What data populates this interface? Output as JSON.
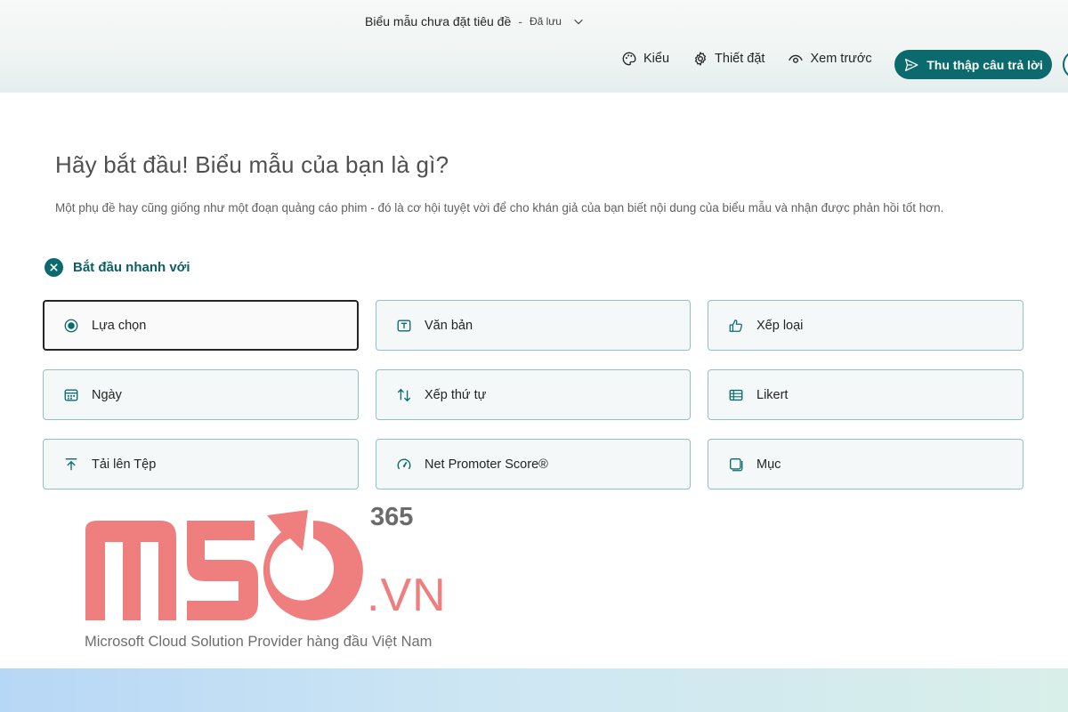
{
  "header": {
    "doc_title": "Biểu mẫu chưa đặt tiêu đề",
    "separator": "-",
    "save_status": "Đã lưu",
    "toolbar": {
      "style_label": "Kiểu",
      "settings_label": "Thiết đặt",
      "preview_label": "Xem trước",
      "collect_label": "Thu thập câu trả lời"
    }
  },
  "main": {
    "title": "Hãy bắt đầu! Biểu mẫu của bạn là gì?",
    "subtitle": "Một phụ đề hay cũng giống như một đoạn quảng cáo phim - đó là cơ hội tuyệt vời để cho khán giả của bạn biết nội dung của biểu mẫu và nhận được phản hồi tốt hơn.",
    "quick_start_label": "Bắt đầu nhanh với",
    "question_types": [
      {
        "label": "Lựa chọn",
        "icon": "radio-icon",
        "selected": true
      },
      {
        "label": "Văn bản",
        "icon": "text-box-icon"
      },
      {
        "label": "Xếp loại",
        "icon": "thumbs-up-icon"
      },
      {
        "label": "Ngày",
        "icon": "calendar-icon"
      },
      {
        "label": "Xếp thứ tự",
        "icon": "sort-arrows-icon"
      },
      {
        "label": "Likert",
        "icon": "likert-grid-icon"
      },
      {
        "label": "Tải lên Tệp",
        "icon": "upload-icon"
      },
      {
        "label": "Net Promoter Score®",
        "icon": "gauge-icon"
      },
      {
        "label": "Mục",
        "icon": "section-icon"
      }
    ]
  },
  "watermark": {
    "number": "365",
    "domain": ".VN",
    "tagline": "Microsoft Cloud Solution Provider hàng đầu Việt Nam"
  },
  "colors": {
    "accent": "#0b6a6d",
    "card_border": "#8cc4c2",
    "logo": "#ef7e7e"
  }
}
